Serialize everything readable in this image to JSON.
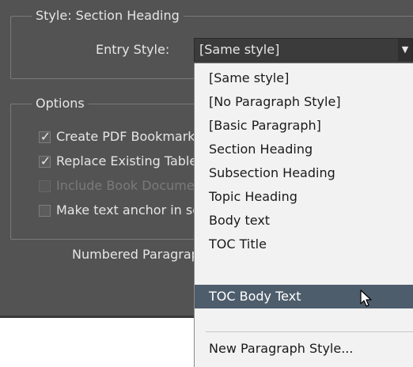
{
  "style_section": {
    "legend": "Style: Section Heading",
    "entry_style_label": "Entry Style:",
    "entry_style_value": "[Same style]"
  },
  "options": {
    "legend": "Options",
    "checkboxes": [
      {
        "label": "Create PDF Bookmarks",
        "checked": true,
        "enabled": true
      },
      {
        "label": "Replace Existing Table of Contents",
        "checked": true,
        "enabled": true
      },
      {
        "label": "Include Book Documents",
        "checked": false,
        "enabled": false
      },
      {
        "label": "Make text anchor in source paragraph",
        "checked": false,
        "enabled": true
      }
    ],
    "numbered_label": "Numbered Paragraphs:"
  },
  "dropdown": {
    "items": [
      "[Same style]",
      "[No Paragraph Style]",
      "[Basic Paragraph]",
      "Section Heading",
      "Subsection Heading",
      "Topic Heading",
      "Body text",
      "TOC Title",
      "TOC Body Text"
    ],
    "selected_index": 8,
    "footer_item": "New Paragraph Style..."
  },
  "icons": {
    "dropdown_arrow": "chevron-down-icon",
    "checkmark": "checkmark-icon",
    "cursor": "mouse-pointer-icon"
  },
  "colors": {
    "dialog_bg": "#535353",
    "menu_bg": "#f2f2f2",
    "menu_highlight": "#4e5d6c"
  }
}
